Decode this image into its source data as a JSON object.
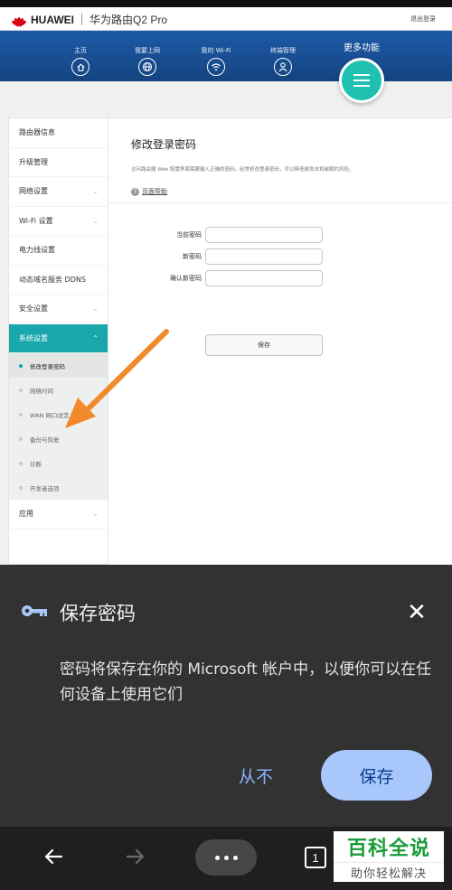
{
  "router": {
    "brand": "HUAWEI",
    "model": "华为路由Q2 Pro",
    "logout": "退出登录",
    "nav": [
      {
        "label": "主页",
        "icon": "home-icon"
      },
      {
        "label": "我要上网",
        "icon": "globe-icon"
      },
      {
        "label": "我的 Wi-Fi",
        "icon": "wifi-icon"
      },
      {
        "label": "终端管理",
        "icon": "user-icon"
      }
    ],
    "more_label": "更多功能",
    "sidebar": {
      "items": [
        {
          "label": "路由器信息"
        },
        {
          "label": "升级管理"
        },
        {
          "label": "网络设置"
        },
        {
          "label": "Wi-Fi 设置"
        },
        {
          "label": "电力线设置"
        },
        {
          "label": "动态域名服务 DDNS"
        },
        {
          "label": "安全设置"
        },
        {
          "label": "系统设置"
        },
        {
          "label": "应用"
        }
      ],
      "subitems": [
        {
          "label": "修改登录密码"
        },
        {
          "label": "网络时间"
        },
        {
          "label": "WAN 网口设定"
        },
        {
          "label": "备份与恢复"
        },
        {
          "label": "诊断"
        },
        {
          "label": "开发者选项"
        }
      ]
    },
    "panel": {
      "title": "修改登录密码",
      "description": "访问路由器 Web 配置界面需要输入正确的密码。经常修改登录密码，可以降低被攻击和破解的风险。",
      "help": "页面帮助",
      "fields": [
        {
          "label": "当前密码",
          "value": ""
        },
        {
          "label": "新密码",
          "value": ""
        },
        {
          "label": "确认新密码",
          "value": ""
        }
      ],
      "save_label": "保存"
    }
  },
  "dialog": {
    "title": "保存密码",
    "body": "密码将保存在你的 Microsoft 帐户中，以便你可以在任何设备上使用它们",
    "never_label": "从不",
    "save_label": "保存",
    "key_icon": "key-icon",
    "close_icon": "close-icon"
  },
  "toolbar": {
    "tab_count": "1"
  },
  "watermark": {
    "line1": "百科全说",
    "line2": "助你轻松解决"
  },
  "colors": {
    "nav_blue": "#1e5aa8",
    "accent_teal": "#1aa6ad",
    "menu_teal": "#1ec0b0",
    "dialog_bg": "#323232",
    "primary_button": "#a8c7fa",
    "arrow_orange": "#f08a2c"
  }
}
